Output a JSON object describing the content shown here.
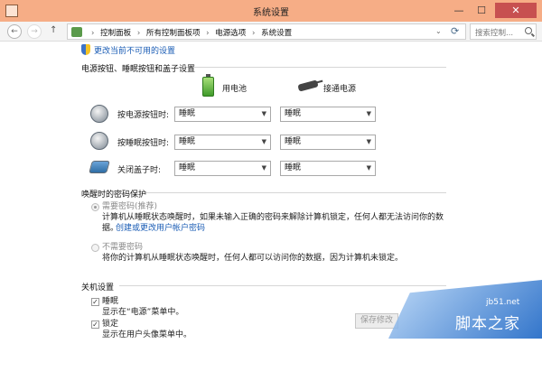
{
  "window": {
    "title": "系统设置",
    "min": "—",
    "max": "☐",
    "close": "✕"
  },
  "nav": {
    "back": "←",
    "forward": "→",
    "up": "↑",
    "breadcrumb": [
      "控制面板",
      "所有控制面板项",
      "电源选项",
      "系统设置"
    ],
    "dropdown": "⌄",
    "refresh": "⟳",
    "search_placeholder": "搜索控制..."
  },
  "change_settings_link": "更改当前不可用的设置",
  "power_section": {
    "title": "电源按钮、睡眠按钮和盖子设置",
    "battery_label": "用电池",
    "plugged_label": "接通电源",
    "rows": [
      {
        "label": "按电源按钮时:",
        "battery": "睡眠",
        "plugged": "睡眠"
      },
      {
        "label": "按睡眠按钮时:",
        "battery": "睡眠",
        "plugged": "睡眠"
      },
      {
        "label": "关闭盖子时:",
        "battery": "睡眠",
        "plugged": "睡眠"
      }
    ]
  },
  "password_section": {
    "title": "唤醒时的密码保护",
    "require_label": "需要密码(推荐)",
    "require_desc_1": "计算机从睡眠状态唤醒时，如果未输入正确的密码来解除计算机锁定，任何人都无法访问你的数",
    "require_desc_2": "据。",
    "create_link": "创建或更改用户帐户密码",
    "no_require_label": "不需要密码",
    "no_require_desc": "将你的计算机从睡眠状态唤醒时，任何人都可以访问你的数据，因为计算机未锁定。"
  },
  "shutdown_section": {
    "title": "关机设置",
    "items": [
      {
        "label": "睡眠",
        "desc": "显示在“电源”菜单中。",
        "checked": true
      },
      {
        "label": "锁定",
        "desc": "显示在用户头像菜单中。",
        "checked": true
      }
    ]
  },
  "save_button": "保存修改",
  "watermark": {
    "url": "jb51.net",
    "text": "脚本之家"
  }
}
